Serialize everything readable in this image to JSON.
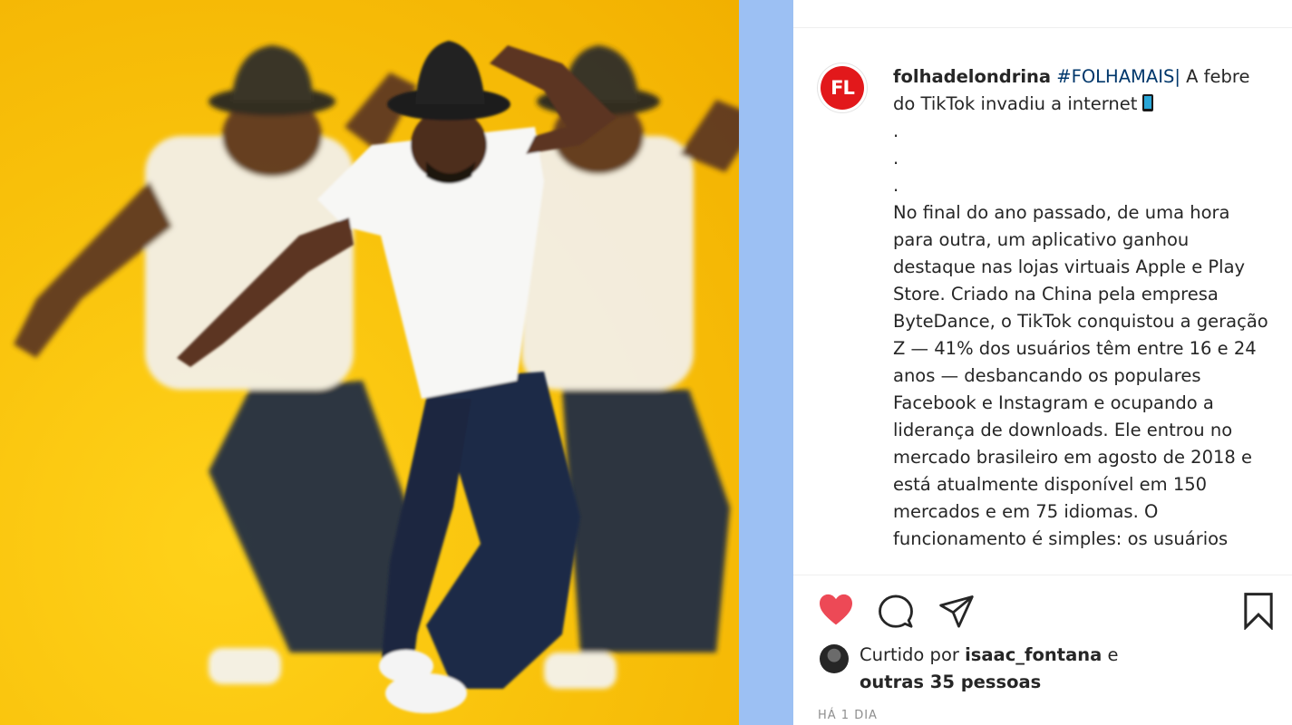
{
  "post": {
    "avatar_text": "FL",
    "username": "folhadelondrina",
    "hashtag": "#FOLHAMAIS|",
    "caption_intro": "A febre do TikTok invadiu a internet",
    "dots": [
      ".",
      ".",
      "."
    ],
    "caption_body": "No final do ano passado, de uma hora para outra, um aplicativo ganhou destaque nas lojas virtuais Apple e Play Store. Criado na China pela empresa ByteDance, o TikTok conquistou a geração Z — 41% dos usuários têm entre 16 e 24 anos — desbancando os populares Facebook e Instagram e ocupando a liderança de downloads. Ele entrou no mercado brasileiro em agosto de 2018 e está atualmente disponível em 150 mercados e em 75 idiomas. O funcionamento é simples: os usuários",
    "liked_state": true
  },
  "likes": {
    "prefix": "Curtido por",
    "user": "isaac_fontana",
    "conjunction": "e",
    "others": "outras 35 pessoas"
  },
  "timestamp": "HÁ 1 DIA",
  "icons": {
    "like": "heart-icon",
    "comment": "comment-icon",
    "share": "share-icon",
    "save": "bookmark-icon"
  },
  "colors": {
    "background_yellow": "#f9c30c",
    "side_strip": "#9cc0f3",
    "heart_red": "#ed4956",
    "brand_red": "#e2181b",
    "hashtag_blue": "#00376b",
    "text": "#262626",
    "muted": "#8e8e8e"
  }
}
